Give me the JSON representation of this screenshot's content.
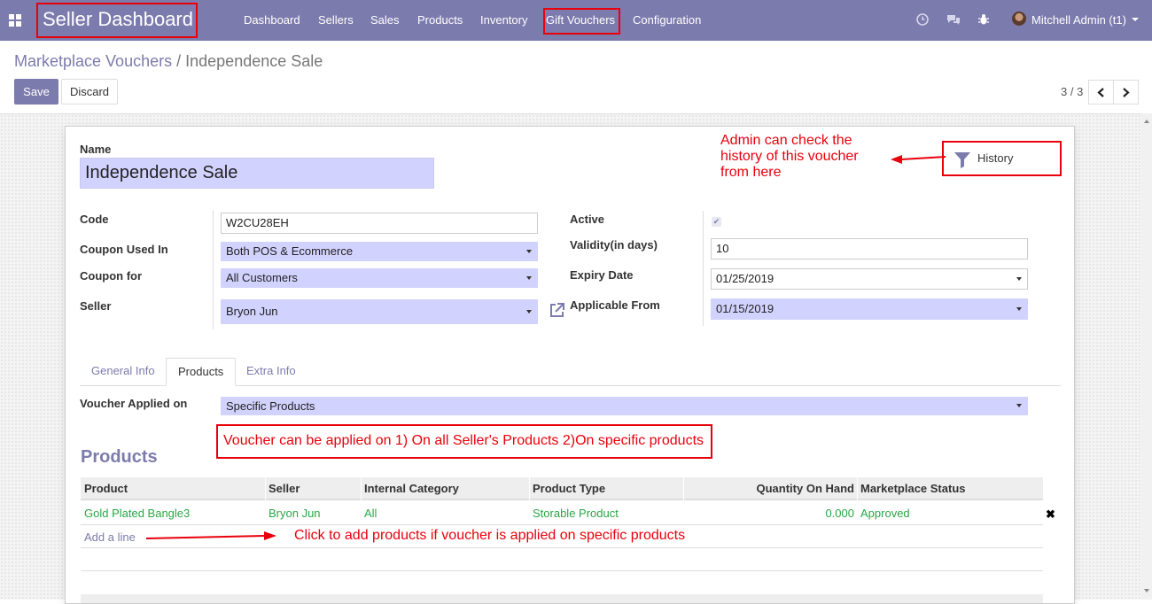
{
  "nav": {
    "brand": "Seller Dashboard",
    "menu": [
      "Dashboard",
      "Sellers",
      "Sales",
      "Products",
      "Inventory",
      "Gift Vouchers",
      "Configuration"
    ],
    "user": "Mitchell Admin (t1)",
    "icons": [
      "apps-icon",
      "clock-icon",
      "chat-icon",
      "bug-icon"
    ]
  },
  "breadcrumb": {
    "parent": "Marketplace Vouchers",
    "separator": "/",
    "current": "Independence Sale"
  },
  "actions": {
    "save": "Save",
    "discard": "Discard"
  },
  "pager": {
    "value": "3 / 3"
  },
  "form": {
    "name_label": "Name",
    "name_value": "Independence Sale",
    "history_label": "History",
    "left": [
      {
        "label": "Code",
        "value": "W2CU28EH"
      },
      {
        "label": "Coupon Used In",
        "value": "Both POS & Ecommerce"
      },
      {
        "label": "Coupon for",
        "value": "All Customers"
      },
      {
        "label": "Seller",
        "value": "Bryon Jun"
      }
    ],
    "right": [
      {
        "label": "Active",
        "value": ""
      },
      {
        "label": "Validity(in days)",
        "value": "10"
      },
      {
        "label": "Expiry Date",
        "value": "01/25/2019"
      },
      {
        "label": "Applicable From",
        "value": "01/15/2019"
      }
    ],
    "active_checked": true
  },
  "tabs": [
    "General Info",
    "Products",
    "Extra Info"
  ],
  "active_tab": "Products",
  "voucher_applied": {
    "label": "Voucher Applied on",
    "value": "Specific Products"
  },
  "products_section": {
    "title": "Products",
    "columns": [
      "Product",
      "Seller",
      "Internal Category",
      "Product Type",
      "Quantity On Hand",
      "Marketplace Status"
    ],
    "rows": [
      [
        "Gold Plated Bangle3",
        "Bryon Jun",
        "All",
        "Storable Product",
        "0.000",
        "Approved"
      ]
    ],
    "add_line": "Add a line"
  },
  "annotations": {
    "history_note": [
      "Admin can check the",
      "history of this voucher",
      "from here"
    ],
    "voucher_note": "Voucher can be applied on 1) On all Seller's Products  2)On specific products",
    "addline_note": "Click to add products if voucher is applied on specific products"
  },
  "colors": {
    "primary": "#7c7bad",
    "annotation": "#e8000b",
    "link_green": "#28a745",
    "required_field": "#d2d2ff"
  }
}
